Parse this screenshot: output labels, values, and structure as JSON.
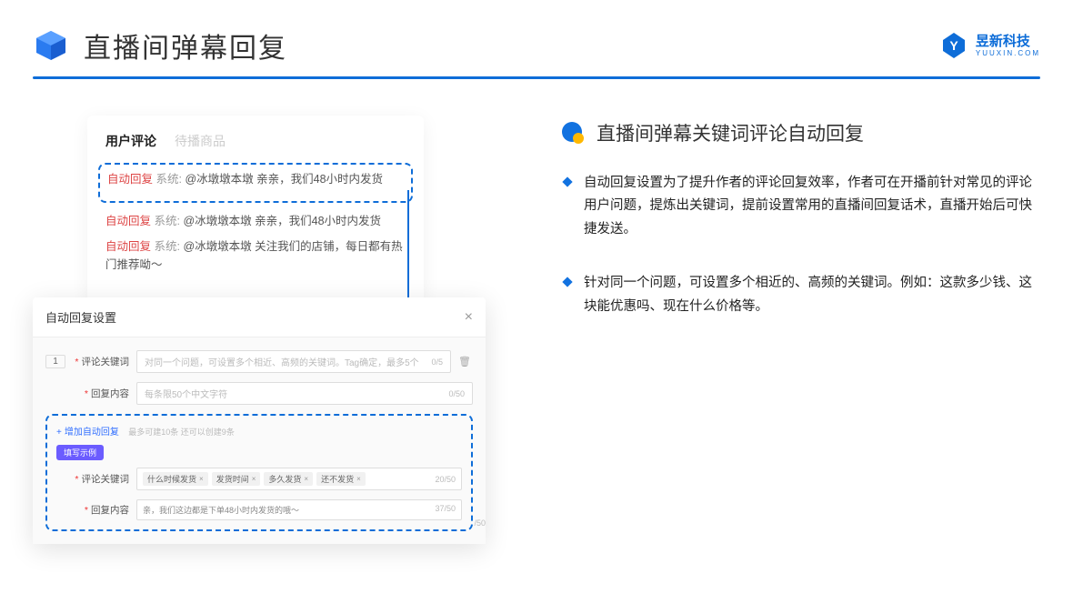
{
  "header": {
    "title": "直播间弹幕回复",
    "logo_cn": "昱新科技",
    "logo_en": "YUUXIN.COM"
  },
  "comments_card": {
    "tab_active": "用户评论",
    "tab_inactive": "待播商品",
    "items": [
      {
        "auto": "自动回复",
        "sys": "系统:",
        "body": "@冰墩墩本墩 亲亲，我们48小时内发货"
      },
      {
        "auto": "自动回复",
        "sys": "系统:",
        "body": "@冰墩墩本墩 亲亲，我们48小时内发货"
      },
      {
        "auto": "自动回复",
        "sys": "系统:",
        "body": "@冰墩墩本墩 关注我们的店铺，每日都有热门推荐呦～"
      }
    ]
  },
  "modal": {
    "title": "自动回复设置",
    "index": "1",
    "keyword_label": "评论关键词",
    "keyword_placeholder": "对同一个问题，可设置多个相近、高频的关键词。Tag确定，最多5个",
    "keyword_count": "0/5",
    "content_label": "回复内容",
    "content_placeholder": "每条限50个中文字符",
    "content_count": "0/50",
    "add_link": "增加自动回复",
    "add_hint": "最多可建10条 还可以创建9条",
    "example_badge": "填写示例",
    "ex_keyword_label": "评论关键词",
    "ex_chips": [
      "什么时候发货",
      "发货时间",
      "多久发货",
      "还不发货"
    ],
    "ex_keyword_count": "20/50",
    "ex_content_label": "回复内容",
    "ex_content_text": "亲，我们这边都是下单48小时内发货的哦～",
    "ex_content_count": "37/50",
    "extra_count": "/50"
  },
  "right": {
    "section_title": "直播间弹幕关键词评论自动回复",
    "bullets": [
      "自动回复设置为了提升作者的评论回复效率，作者可在开播前针对常见的评论用户问题，提炼出关键词，提前设置常用的直播间回复话术，直播开始后可快捷发送。",
      "针对同一个问题，可设置多个相近的、高频的关键词。例如：这款多少钱、这块能优惠吗、现在什么价格等。"
    ]
  }
}
